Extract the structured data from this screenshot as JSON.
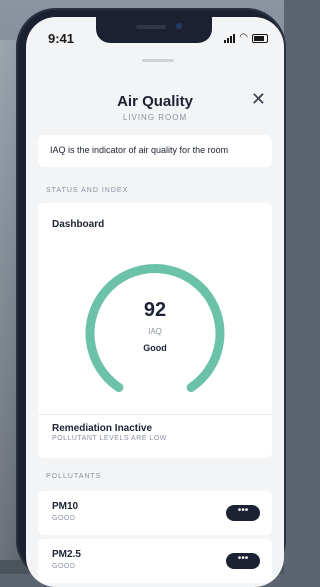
{
  "status_bar": {
    "time": "9:41"
  },
  "header": {
    "title": "Air Quality",
    "subtitle": "LIVING ROOM",
    "close_symbol": "✕"
  },
  "info": {
    "text": "IAQ is the indicator of air quality for the room"
  },
  "sections": {
    "status_index": "STATUS AND INDEX",
    "pollutants": "POLLUTANTS"
  },
  "dashboard": {
    "title": "Dashboard",
    "gauge": {
      "value": "92",
      "unit": "IAQ",
      "status": "Good",
      "color": "#6bc2a8"
    }
  },
  "remediation": {
    "title": "Remediation Inactive",
    "subtitle": "POLLUTANT LEVELS ARE LOW"
  },
  "pollutants": [
    {
      "name": "PM10",
      "status": "GOOD",
      "action_label": "•••"
    },
    {
      "name": "PM2.5",
      "status": "GOOD",
      "action_label": "•••"
    }
  ]
}
